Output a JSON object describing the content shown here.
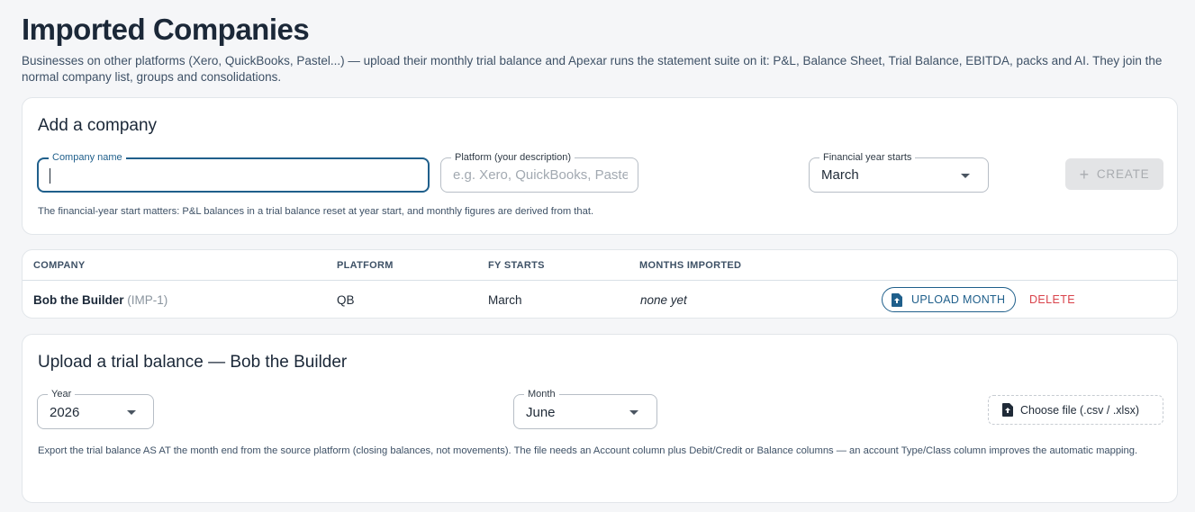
{
  "page": {
    "title": "Imported Companies",
    "description": "Businesses on other platforms (Xero, QuickBooks, Pastel...) — upload their monthly trial balance and Apexar runs the statement suite on it: P&L, Balance Sheet, Trial Balance, EBITDA, packs and AI. They join the normal company list, groups and consolidations."
  },
  "add_company": {
    "title": "Add a company",
    "company_name": {
      "label": "Company name",
      "value": ""
    },
    "platform": {
      "label": "Platform (your description)",
      "placeholder": "e.g. Xero, QuickBooks, Pastel"
    },
    "fy_start": {
      "label": "Financial year starts",
      "value": "March"
    },
    "create_label": "CREATE",
    "hint": "The financial-year start matters: P&L balances in a trial balance reset at year start, and monthly figures are derived from that."
  },
  "table": {
    "headers": [
      "COMPANY",
      "PLATFORM",
      "FY STARTS",
      "MONTHS IMPORTED"
    ],
    "rows": [
      {
        "company": "Bob the Builder",
        "code": "(IMP-1)",
        "platform": "QB",
        "fy_starts": "March",
        "months_imported": "none yet",
        "upload_label": "UPLOAD MONTH",
        "delete_label": "DELETE"
      }
    ]
  },
  "upload": {
    "title": "Upload a trial balance — Bob the Builder",
    "year": {
      "label": "Year",
      "value": "2026"
    },
    "month": {
      "label": "Month",
      "value": "June"
    },
    "choose_file_label": "Choose file (.csv / .xlsx)",
    "hint": "Export the trial balance AS AT the month end from the source platform (closing balances, not movements). The file needs an Account column plus Debit/Credit or Balance columns — an account Type/Class column improves the automatic mapping."
  },
  "colors": {
    "accent": "#1f5f8b",
    "danger": "#d9434b",
    "background": "#f5f6f8",
    "card": "#ffffff"
  },
  "icons": [
    "upload-file-icon",
    "plus-icon",
    "chevron-down-icon"
  ]
}
